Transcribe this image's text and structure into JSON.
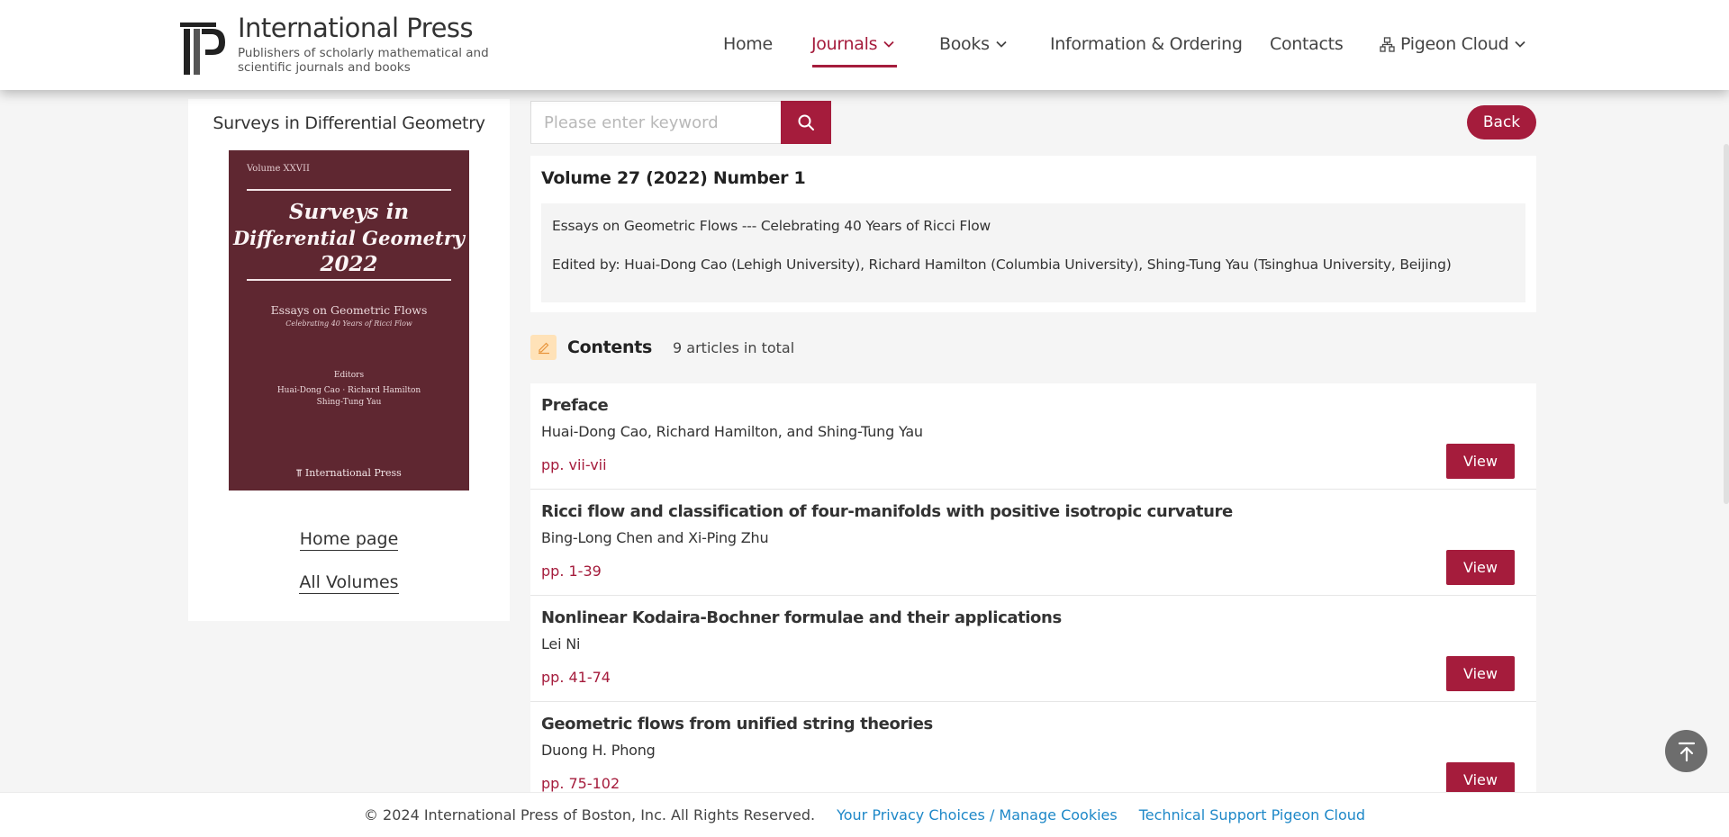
{
  "brand": {
    "name": "International Press",
    "tagline": "Publishers of scholarly mathematical and scientific journals and books"
  },
  "nav": {
    "home": "Home",
    "journals": "Journals",
    "books": "Books",
    "info": "Information & Ordering",
    "contacts": "Contacts",
    "pigeon": "Pigeon Cloud"
  },
  "sidebar": {
    "journal_title": "Surveys in Differential Geometry",
    "cover": {
      "volume": "Volume XXVII",
      "title_line1": "Surveys in",
      "title_line2": "Differential Geometry",
      "title_line3": "2022",
      "subtitle": "Essays on Geometric Flows",
      "subtitle2": "Celebrating 40 Years of Ricci Flow",
      "editors_label": "Editors",
      "editors_line1": "Huai-Dong Cao · Richard Hamilton",
      "editors_line2": "Shing-Tung Yau",
      "publisher": "International Press"
    },
    "home_page": "Home page",
    "all_volumes": "All Volumes"
  },
  "search": {
    "placeholder": "Please enter keyword"
  },
  "back_label": "Back",
  "issue": {
    "title": "Volume 27 (2022) Number 1",
    "theme": "Essays on Geometric Flows --- Celebrating 40 Years of Ricci Flow",
    "editors": "Edited by: Huai-Dong Cao (Lehigh University), Richard Hamilton (Columbia University), Shing-Tung Yau (Tsinghua University, Beijing)"
  },
  "contents": {
    "label": "Contents",
    "count": "9 articles in total"
  },
  "articles": [
    {
      "title": "Preface",
      "authors": "Huai-Dong Cao, Richard Hamilton, and Shing-Tung Yau",
      "pages": "pp. vii-vii",
      "button": "View"
    },
    {
      "title": "Ricci flow and classification of four-manifolds with positive isotropic curvature",
      "authors": "Bing-Long Chen and Xi-Ping Zhu",
      "pages": "pp. 1-39",
      "button": "View"
    },
    {
      "title": "Nonlinear Kodaira-Bochner formulae and their applications",
      "authors": "Lei Ni",
      "pages": "pp. 41-74",
      "button": "View"
    },
    {
      "title": "Geometric flows from unified string theories",
      "authors": "Duong H. Phong",
      "pages": "pp. 75-102",
      "button": "View"
    }
  ],
  "footer": {
    "copyright": "© 2024 International Press of Boston, Inc. All Rights Reserved.",
    "privacy": "Your Privacy Choices / Manage Cookies",
    "support": "Technical Support Pigeon Cloud"
  },
  "colors": {
    "accent": "#a51c3c",
    "cover": "#5f2731",
    "link": "#1e88c8"
  }
}
